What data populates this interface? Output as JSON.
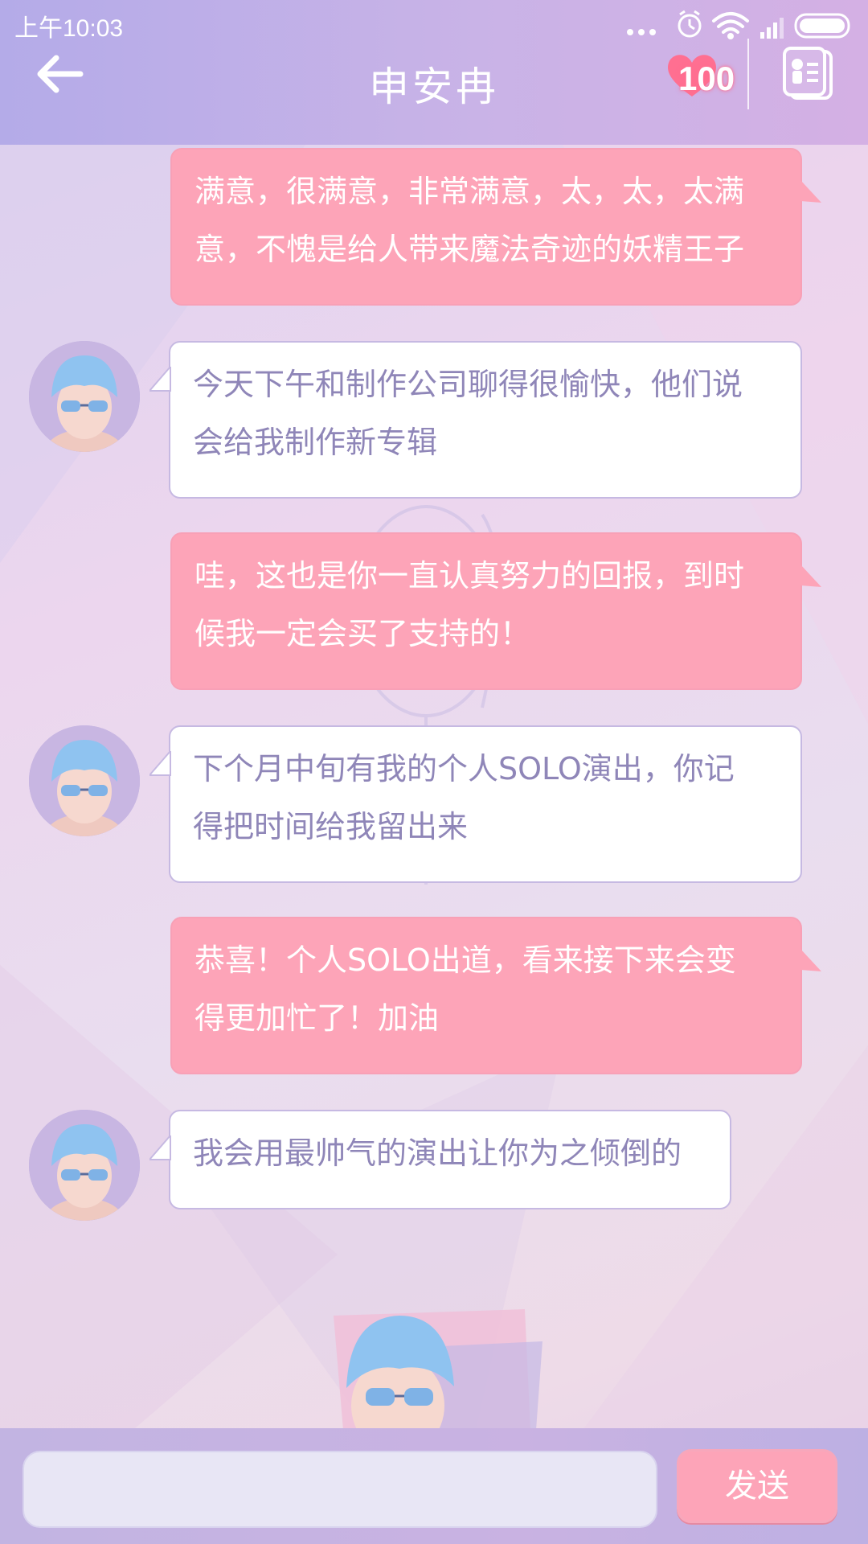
{
  "status_bar": {
    "time": "上午10:03"
  },
  "header": {
    "title": "申安冉",
    "favor_value": "100"
  },
  "messages": [
    {
      "from": "me",
      "line1": "满意，很满意，非常满意，太，太，太满",
      "line2": "意，不愧是给人带来魔法奇迹的妖精王子"
    },
    {
      "from": "them",
      "line1": "今天下午和制作公司聊得很愉快，他们说",
      "line2": "会给我制作新专辑"
    },
    {
      "from": "me",
      "line1": "哇，这也是你一直认真努力的回报，到时",
      "line2": "候我一定会买了支持的！"
    },
    {
      "from": "them",
      "line1": "下个月中旬有我的个人SOLO演出，你记",
      "line2": "得把时间给我留出来"
    },
    {
      "from": "me",
      "line1": "恭喜！个人SOLO出道，看来接下来会变",
      "line2": "得更加忙了！加油"
    },
    {
      "from": "them",
      "line1": "我会用最帅气的演出让你为之倾倒的",
      "line2": ""
    }
  ],
  "input": {
    "value": "",
    "placeholder": ""
  },
  "send_button": {
    "label": "发送"
  },
  "colors": {
    "my_bubble": "#fda4b8",
    "their_text": "#8f86b8",
    "header": "#c9b3e7"
  },
  "icons": [
    "back-arrow-icon",
    "heart-icon",
    "contact-card-icon",
    "dots-icon",
    "alarm-icon",
    "wifi-icon",
    "signal-icon",
    "battery-icon"
  ]
}
